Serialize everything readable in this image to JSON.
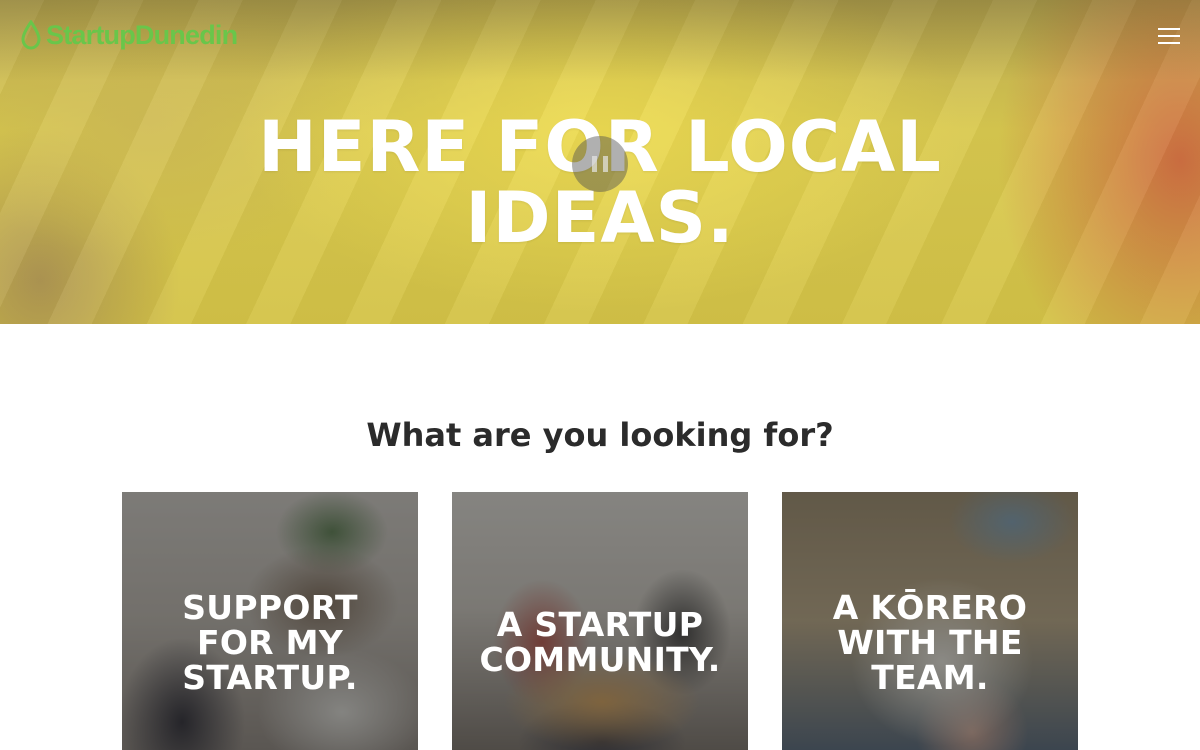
{
  "header": {
    "logo_text": "StartupDunedin",
    "logo_color": "#69c64a",
    "menu_icon": "hamburger-menu-icon"
  },
  "hero": {
    "title_line1": "HERE FOR LOCAL",
    "title_line2": "IDEAS.",
    "video_control_icon": "pause-icon"
  },
  "section": {
    "heading": "What are you looking for?"
  },
  "cards": [
    {
      "lines": [
        "SUPPORT",
        "FOR MY",
        "STARTUP."
      ]
    },
    {
      "lines": [
        "A STARTUP",
        "COMMUNITY."
      ]
    },
    {
      "lines": [
        "A KŌRERO",
        "WITH THE",
        "TEAM."
      ]
    }
  ],
  "colors": {
    "heading_text": "#2b2b2b",
    "hero_text": "#ffffff"
  }
}
